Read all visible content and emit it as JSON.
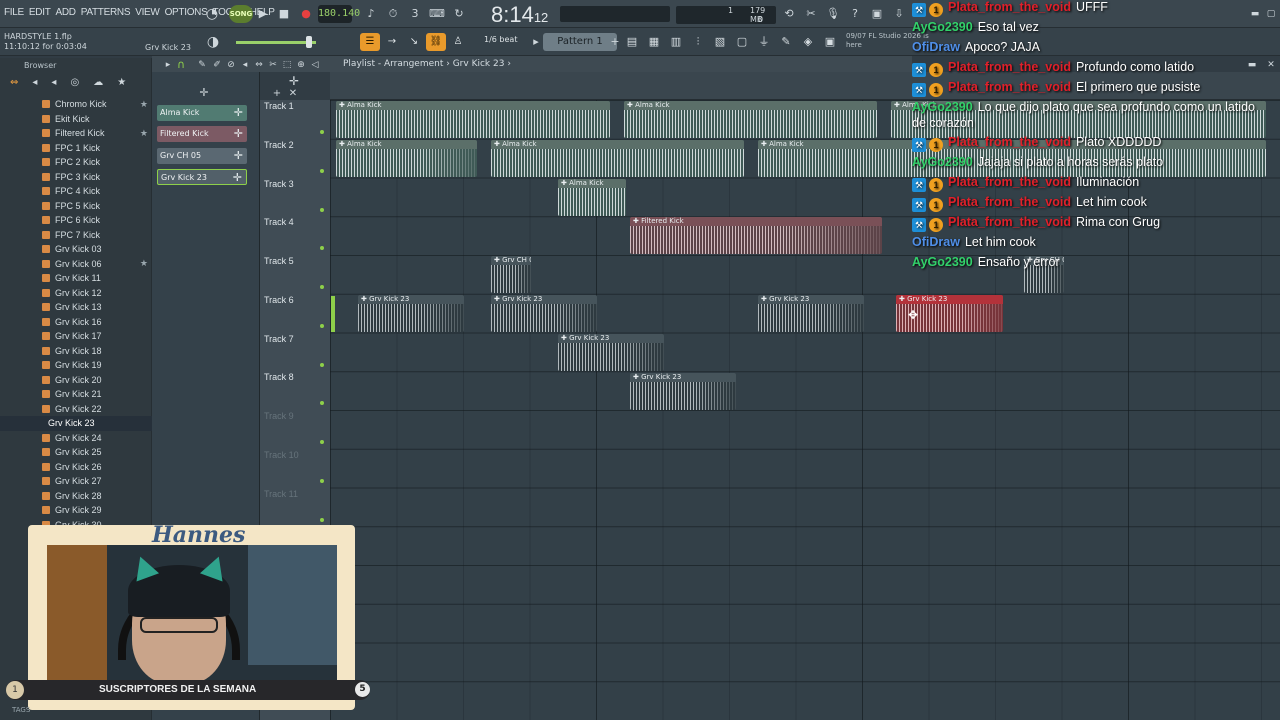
{
  "menu": [
    "FILE",
    "EDIT",
    "ADD",
    "PATTERNS",
    "VIEW",
    "OPTIONS",
    "TOOLS",
    "HELP"
  ],
  "transport": {
    "mode": "SONG",
    "tempo": "180.140",
    "time": "8:14",
    "time_sub": "12",
    "memory": "179 MB",
    "cpu_a": "1",
    "cpu_b": "0"
  },
  "file": {
    "name": "HARDSTYLE 1.flp",
    "time_info": "11:10:12 for 0:03:04",
    "hint": "Grv Kick 23"
  },
  "snap": "1/6 beat",
  "pattern": "Pattern 1",
  "news": {
    "date": "09/07",
    "text": "FL Studio 2026 is",
    "more": "here"
  },
  "browser": {
    "title": "Browser",
    "items": [
      {
        "label": "Chromo Kick",
        "star": true
      },
      {
        "label": "Ekit Kick",
        "star": false
      },
      {
        "label": "Filtered Kick",
        "star": true
      },
      {
        "label": "FPC 1 Kick",
        "star": false
      },
      {
        "label": "FPC 2 Kick",
        "star": false
      },
      {
        "label": "FPC 3 Kick",
        "star": false
      },
      {
        "label": "FPC 4 Kick",
        "star": false
      },
      {
        "label": "FPC 5 Kick",
        "star": false
      },
      {
        "label": "FPC 6 Kick",
        "star": false
      },
      {
        "label": "FPC 7 Kick",
        "star": false
      },
      {
        "label": "Grv Kick 03",
        "star": false
      },
      {
        "label": "Grv Kick 06",
        "star": true
      },
      {
        "label": "Grv Kick 11",
        "star": false
      },
      {
        "label": "Grv Kick 12",
        "star": false
      },
      {
        "label": "Grv Kick 13",
        "star": false
      },
      {
        "label": "Grv Kick 16",
        "star": false
      },
      {
        "label": "Grv Kick 17",
        "star": false
      },
      {
        "label": "Grv Kick 18",
        "star": false
      },
      {
        "label": "Grv Kick 19",
        "star": false
      },
      {
        "label": "Grv Kick 20",
        "star": false
      },
      {
        "label": "Grv Kick 21",
        "star": false
      },
      {
        "label": "Grv Kick 22",
        "star": false
      },
      {
        "label": "Grv Kick 23",
        "star": false,
        "selected": true
      },
      {
        "label": "Grv Kick 24",
        "star": false
      },
      {
        "label": "Grv Kick 25",
        "star": false
      },
      {
        "label": "Grv Kick 26",
        "star": false
      },
      {
        "label": "Grv Kick 27",
        "star": false
      },
      {
        "label": "Grv Kick 28",
        "star": false
      },
      {
        "label": "Grv Kick 29",
        "star": false
      },
      {
        "label": "Grv Kick 30",
        "star": false
      }
    ]
  },
  "picker": [
    "Alma Kick",
    "Filtered Kick",
    "Grv CH 05",
    "Grv Kick 23"
  ],
  "playlist": {
    "title": "Playlist - Arrangement",
    "current": "Grv Kick 23",
    "tracks": [
      "Track 1",
      "Track 2",
      "Track 3",
      "Track 4",
      "Track 5",
      "Track 6",
      "Track 7",
      "Track 8",
      "Track 9",
      "Track 10",
      "Track 11"
    ],
    "clip_names": {
      "alma": "Alma Kick",
      "filtered": "Filtered Kick",
      "grvch": "Grv CH 05",
      "grv23": "Grv Kick 23"
    }
  },
  "chat": [
    {
      "user": "Plata_from_the_void",
      "color": "#e0202a",
      "badges": true,
      "msg": "UFFF"
    },
    {
      "user": "AyGo2390",
      "color": "#32d16a",
      "badges": false,
      "msg": "Eso tal vez"
    },
    {
      "user": "OfiDraw",
      "color": "#4f8fe8",
      "badges": false,
      "msg": "Apoco? JAJA"
    },
    {
      "user": "Plata_from_the_void",
      "color": "#e0202a",
      "badges": true,
      "msg": "Profundo como latido"
    },
    {
      "user": "Plata_from_the_void",
      "color": "#e0202a",
      "badges": true,
      "msg": "El primero que pusiste"
    },
    {
      "user": "AyGo2390",
      "color": "#32d16a",
      "badges": false,
      "msg": "Lo que dijo plato que sea profundo como un latido"
    },
    {
      "user": "",
      "color": "#ffffff",
      "badges": false,
      "msg": "de corazón"
    },
    {
      "user": "Plata_from_the_void",
      "color": "#e0202a",
      "badges": true,
      "msg": "Plato XDDDDD"
    },
    {
      "user": "AyGo2390",
      "color": "#32d16a",
      "badges": false,
      "msg": "Jajaja si plato a horas serás plato"
    },
    {
      "user": "Plata_from_the_void",
      "color": "#e0202a",
      "badges": true,
      "msg": "Iluminación"
    },
    {
      "user": "Plata_from_the_void",
      "color": "#e0202a",
      "badges": true,
      "msg": "Let him cook"
    },
    {
      "user": "Plata_from_the_void",
      "color": "#e0202a",
      "badges": true,
      "msg": "Rima con Grug"
    },
    {
      "user": "OfiDraw",
      "color": "#4f8fe8",
      "badges": false,
      "msg": "Let him cook"
    },
    {
      "user": "AyGo2390",
      "color": "#32d16a",
      "badges": false,
      "msg": "Ensaño y error"
    }
  ],
  "webcam": {
    "name": "Hannes",
    "banner": "SUSCRIPTORES DE LA SEMANA",
    "left_num": "1",
    "right_num": "5"
  },
  "tags_label": "TAGS"
}
